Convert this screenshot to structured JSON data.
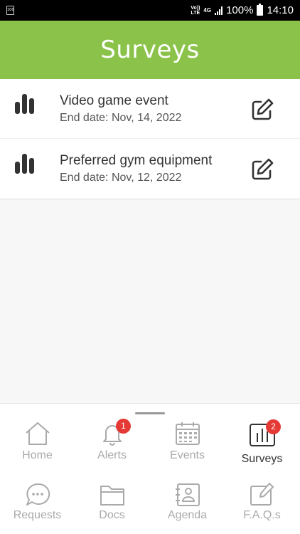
{
  "status_bar": {
    "left_icon_text": "100",
    "volte": "Vo)) LTE",
    "network": "4G",
    "battery": "100%",
    "time": "14:10"
  },
  "header": {
    "title": "Surveys"
  },
  "surveys": [
    {
      "title": "Video game event",
      "end_date": "End date: Nov, 14, 2022"
    },
    {
      "title": "Preferred gym equipment",
      "end_date": "End date: Nov, 12, 2022"
    }
  ],
  "nav": {
    "items": [
      {
        "label": "Home",
        "icon": "home-icon"
      },
      {
        "label": "Alerts",
        "icon": "bell-icon",
        "badge": "1"
      },
      {
        "label": "Events",
        "icon": "calendar-icon"
      },
      {
        "label": "Surveys",
        "icon": "bar-chart-icon",
        "badge": "2",
        "active": true
      },
      {
        "label": "Requests",
        "icon": "chat-icon"
      },
      {
        "label": "Docs",
        "icon": "folder-icon"
      },
      {
        "label": "Agenda",
        "icon": "contacts-icon"
      },
      {
        "label": "F.A.Q.s",
        "icon": "edit-note-icon"
      }
    ]
  },
  "colors": {
    "header_green": "#8bc34a",
    "badge_red": "#e53935",
    "inactive_grey": "#aaaaaa"
  }
}
